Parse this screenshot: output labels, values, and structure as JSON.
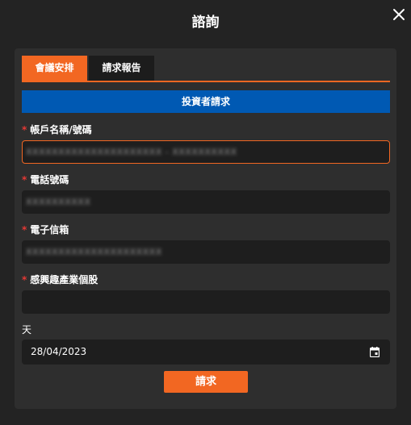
{
  "dialog": {
    "title": "諮詢"
  },
  "tabs": [
    {
      "label": "會議安排",
      "active": true
    },
    {
      "label": "請求報告",
      "active": false
    }
  ],
  "banner": "投資者請求",
  "form": {
    "account": {
      "label": "帳戶名稱/號碼",
      "required": true,
      "value": "XXXXXXXXXXXXXXXXXXXXX - XXXXXXXXXX"
    },
    "phone": {
      "label": "電話號碼",
      "required": true,
      "value": "XXXXXXXXXX"
    },
    "email": {
      "label": "電子信箱",
      "required": true,
      "value": "XXXXXXXXXXXXXXXXXXXXX"
    },
    "stock": {
      "label": "感興趣產業個股",
      "required": true,
      "value": ""
    },
    "date": {
      "label": "天",
      "value": "28/04/2023"
    },
    "submit_label": "請求"
  },
  "colors": {
    "accent": "#f26722",
    "banner": "#0059b3",
    "required_star": "#e53935"
  },
  "icons": {
    "close": "close-icon",
    "calendar": "calendar-icon"
  }
}
